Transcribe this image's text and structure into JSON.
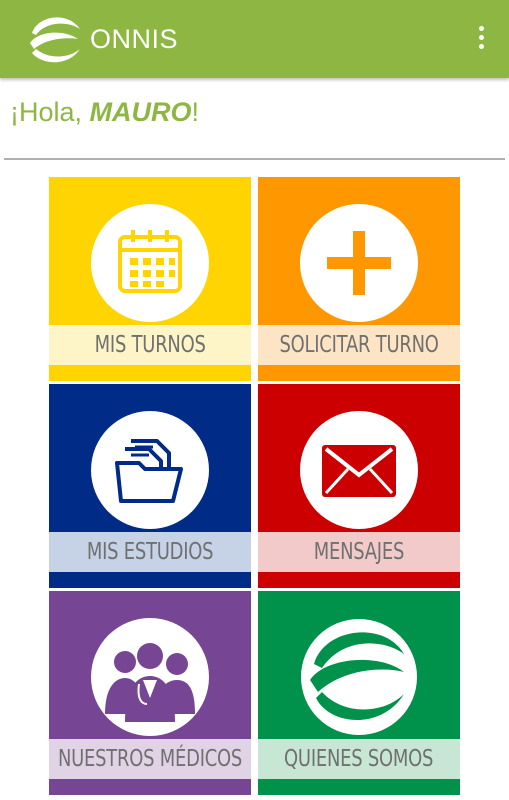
{
  "header": {
    "brand": "ONNIS",
    "logo_icon": "onnis-swirl-logo-icon",
    "overflow_icon": "overflow-menu-icon",
    "background": "#8db642"
  },
  "greeting": {
    "prefix": "¡Hola, ",
    "name": "MAURO",
    "suffix": "!"
  },
  "tiles": [
    {
      "label": "MIS TURNOS",
      "icon": "calendar-icon",
      "color": "#ffd400",
      "band": "#fdf4c8"
    },
    {
      "label": "SOLICITAR TURNO",
      "icon": "plus-icon",
      "color": "#ff9800",
      "band": "#fde4c4"
    },
    {
      "label": "MIS ESTUDIOS",
      "icon": "documents-folder-icon",
      "color": "#002b87",
      "band": "#c6d2e6"
    },
    {
      "label": "MENSAJES",
      "icon": "envelope-icon",
      "color": "#cc0000",
      "band": "#f2caca"
    },
    {
      "label": "NUESTROS MÉDICOS",
      "icon": "doctors-icon",
      "color": "#764593",
      "band": "#e0d3e6"
    },
    {
      "label": "QUIENES SOMOS",
      "icon": "onnis-swirl-icon",
      "color": "#00924a",
      "band": "#c7e6d4"
    }
  ]
}
